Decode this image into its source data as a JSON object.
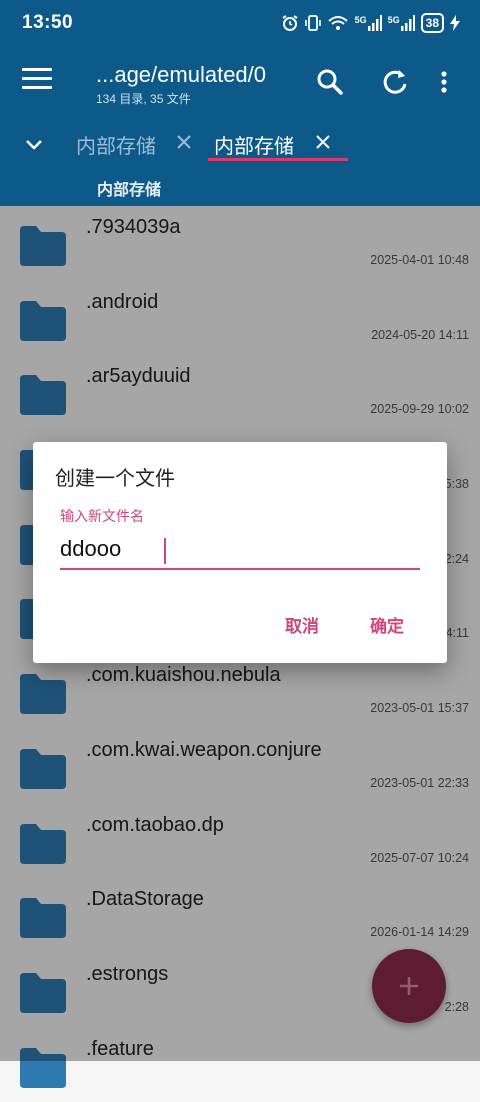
{
  "status_bar": {
    "time": "13:50",
    "network_1": "5G",
    "network_2": "5G",
    "battery": "38"
  },
  "app_bar": {
    "title": "...age/emulated/0",
    "subtitle": "134 目录, 35 文件",
    "tabs": [
      {
        "label": "内部存储"
      },
      {
        "label": "内部存储"
      }
    ],
    "breadcrumb": "内部存储"
  },
  "files": [
    {
      "name": ".7934039a",
      "date": "2025-04-01 10:48"
    },
    {
      "name": ".android",
      "date": "2024-05-20 14:11"
    },
    {
      "name": ".ar5ayduuid",
      "date": "2025-09-29 10:02"
    },
    {
      "name": "",
      "date": "5:38"
    },
    {
      "name": "",
      "date": "2:24"
    },
    {
      "name": "",
      "date": "4:11"
    },
    {
      "name": ".com.kuaishou.nebula",
      "date": "2023-05-01 15:37"
    },
    {
      "name": ".com.kwai.weapon.conjure",
      "date": "2023-05-01 22:33"
    },
    {
      "name": ".com.taobao.dp",
      "date": "2025-07-07 10:24"
    },
    {
      "name": ".DataStorage",
      "date": "2026-01-14 14:29"
    },
    {
      "name": ".estrongs",
      "date": "2:28"
    },
    {
      "name": ".feature",
      "date": ""
    }
  ],
  "dialog": {
    "title": "创建一个文件",
    "field_label": "输入新文件名",
    "field_value": "ddooo",
    "cancel_label": "取消",
    "ok_label": "确定"
  },
  "fab": {
    "icon": "plus-icon"
  },
  "colors": {
    "primary": "#0d5a8a",
    "accent": "#d0457a",
    "folder": "#2e7ab0"
  }
}
